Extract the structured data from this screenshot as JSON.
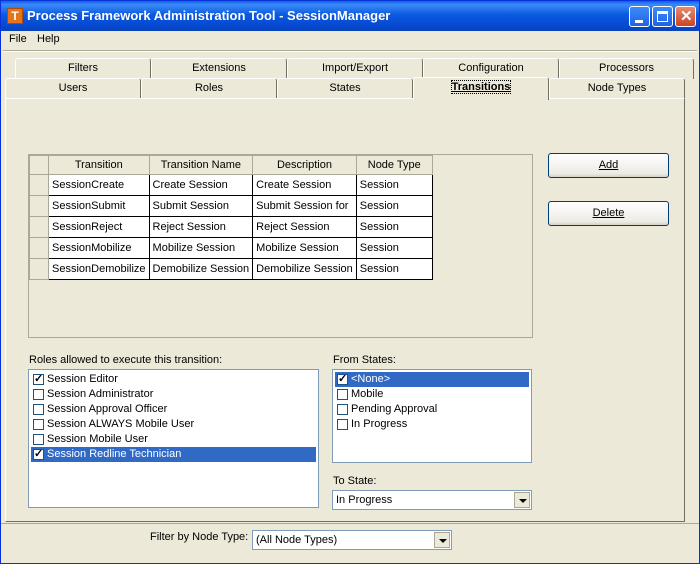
{
  "window": {
    "title": "Process Framework Administration Tool - SessionManager",
    "icon_letter": "T"
  },
  "menu": [
    "File",
    "Help"
  ],
  "tabs_row1": [
    "Filters",
    "Extensions",
    "Import/Export",
    "Configuration",
    "Processors"
  ],
  "tabs_row2": [
    "Users",
    "Roles",
    "States",
    "Transitions",
    "Node Types"
  ],
  "active_tab": "Transitions",
  "grid": {
    "columns": [
      "Transition",
      "Transition Name",
      "Description",
      "Node Type"
    ],
    "rows": [
      [
        "SessionCreate",
        "Create Session",
        "Create Session",
        "Session"
      ],
      [
        "SessionSubmit",
        "Submit Session",
        "Submit Session for",
        "Session"
      ],
      [
        "SessionReject",
        "Reject Session",
        "Reject Session",
        "Session"
      ],
      [
        "SessionMobilize",
        "Mobilize Session",
        "Mobilize Session",
        "Session"
      ],
      [
        "SessionDemobilize",
        "Demobilize Session",
        "Demobilize Session",
        "Session"
      ]
    ]
  },
  "buttons": {
    "add": "Add",
    "delete": "Delete"
  },
  "roles_label": "Roles allowed to execute this transition:",
  "roles": [
    {
      "label": "Session Editor",
      "checked": true,
      "selected": false
    },
    {
      "label": "Session Administrator",
      "checked": false,
      "selected": false
    },
    {
      "label": "Session Approval Officer",
      "checked": false,
      "selected": false
    },
    {
      "label": "Session ALWAYS Mobile User",
      "checked": false,
      "selected": false
    },
    {
      "label": "Session Mobile User",
      "checked": false,
      "selected": false
    },
    {
      "label": "Session Redline Technician",
      "checked": true,
      "selected": true
    }
  ],
  "from_states_label": "From States:",
  "from_states": [
    {
      "label": "<None>",
      "checked": true,
      "selected": true
    },
    {
      "label": "Mobile",
      "checked": false,
      "selected": false
    },
    {
      "label": "Pending Approval",
      "checked": false,
      "selected": false
    },
    {
      "label": "In Progress",
      "checked": false,
      "selected": false
    }
  ],
  "to_state_label": "To State:",
  "to_state_value": "In Progress",
  "filter_label": "Filter by Node Type:",
  "filter_value": "(All Node Types)",
  "colors": {
    "selection": "#316AC5",
    "titlebar": "#0A5FE7",
    "face": "#ECE9D8"
  }
}
